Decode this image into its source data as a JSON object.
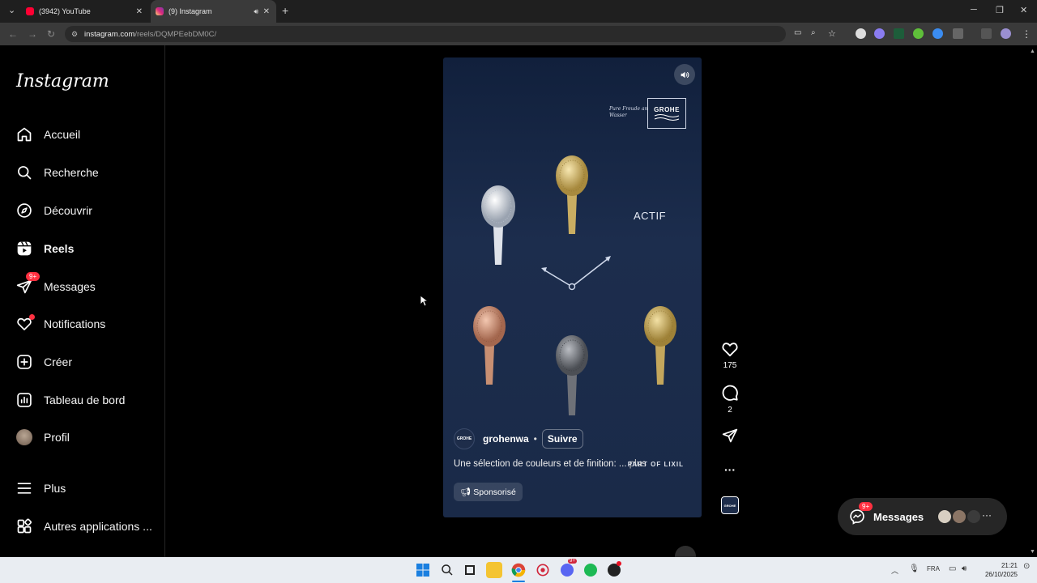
{
  "browser": {
    "tabs": [
      {
        "title": "(3942) YouTube",
        "favicon_color": "#ff0033"
      },
      {
        "title": "(9) Instagram",
        "favicon_color": "#dd2a7b",
        "active": true
      }
    ],
    "url_host": "instagram.com",
    "url_path": "/reels/DQMPEebDM0C/"
  },
  "sidebar": {
    "logo": "Instagram",
    "items": [
      {
        "label": "Accueil",
        "icon": "home-icon"
      },
      {
        "label": "Recherche",
        "icon": "search-icon"
      },
      {
        "label": "Découvrir",
        "icon": "compass-icon"
      },
      {
        "label": "Reels",
        "icon": "reels-icon",
        "active": true
      },
      {
        "label": "Messages",
        "icon": "messenger-icon",
        "badge": "9+"
      },
      {
        "label": "Notifications",
        "icon": "heart-icon",
        "dot": true
      },
      {
        "label": "Créer",
        "icon": "plus-square-icon"
      },
      {
        "label": "Tableau de bord",
        "icon": "dashboard-icon"
      },
      {
        "label": "Profil",
        "icon": "avatar-icon"
      },
      {
        "label": "Plus",
        "icon": "menu-icon"
      },
      {
        "label": "Autres applications ...",
        "icon": "apps-icon"
      }
    ]
  },
  "reel": {
    "brand_tagline": "Pure Freude an Wasser",
    "brand_logo": "GROHE",
    "overlay_text": "ACTIF",
    "account": "grohenwa",
    "follow_label": "Suivre",
    "separator": "•",
    "caption": "Une sélection de couleurs et de finition: ...",
    "more_label": "plus",
    "partner_mark": "PART OF LIXIL",
    "sponsored_label": "Sponsorisé",
    "likes": "175",
    "comments": "2",
    "avatar_text": "GROHE"
  },
  "messages_pill": {
    "label": "Messages",
    "badge": "9+"
  },
  "taskbar": {
    "lang": "FRA",
    "time": "21:21",
    "date": "26/10/2025"
  },
  "colors": {
    "accent_badge": "#ff3040",
    "reel_bg": "#1a2a48",
    "taskbar": "#e9edf2"
  }
}
